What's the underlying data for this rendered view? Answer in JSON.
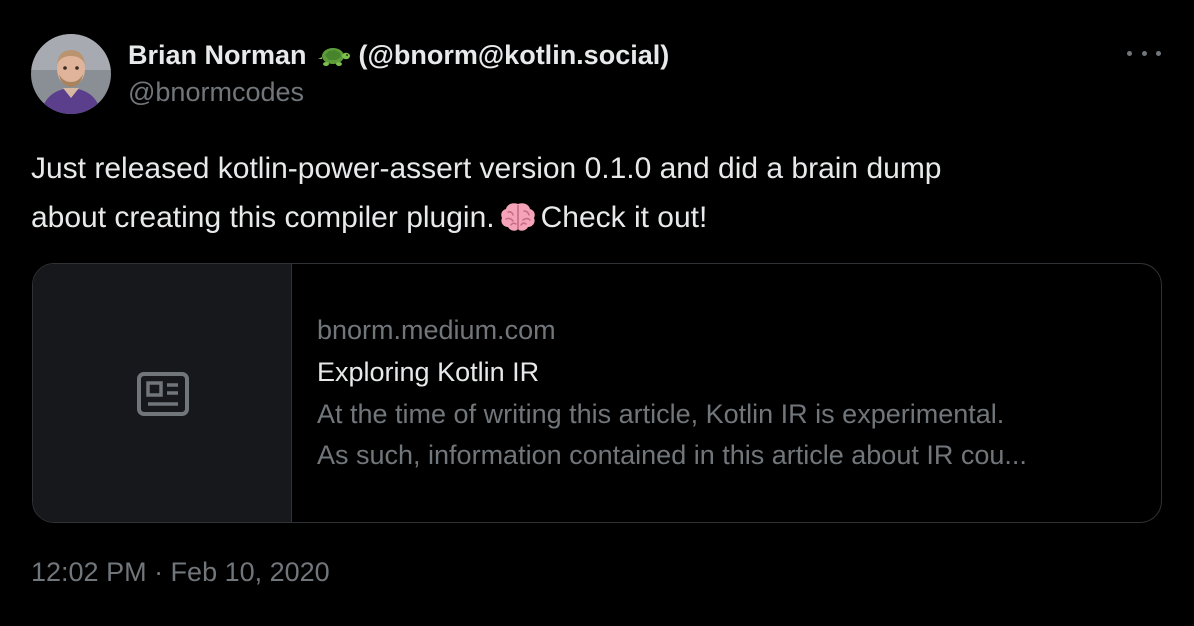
{
  "author": {
    "display_name": "Brian Norman",
    "emoji": "turtle",
    "mastodon": "(@bnorm@kotlin.social)",
    "handle": "@bnormcodes",
    "avatar": "profile-photo"
  },
  "menu": {
    "icon": "more-horizontal-icon"
  },
  "tweet": {
    "text_line1": "Just released kotlin-power-assert version 0.1.0 and did a brain dump",
    "text_line2_before": "about creating this compiler plugin.",
    "text_emoji": "brain",
    "text_line2_after": "Check it out!"
  },
  "link_card": {
    "thumbnail_icon": "news-article-icon",
    "domain": "bnorm.medium.com",
    "title": "Exploring Kotlin IR",
    "description_line1": "At the time of writing this article, Kotlin IR is experimental.",
    "description_line2": "As such, information contained in this article about IR cou..."
  },
  "timestamp": "12:02 PM · Feb 10, 2020",
  "colors": {
    "background": "#000000",
    "text_primary": "#e7e9ea",
    "text_secondary": "#71767b",
    "border": "#2f3336",
    "card_thumb_bg": "#16181c"
  }
}
